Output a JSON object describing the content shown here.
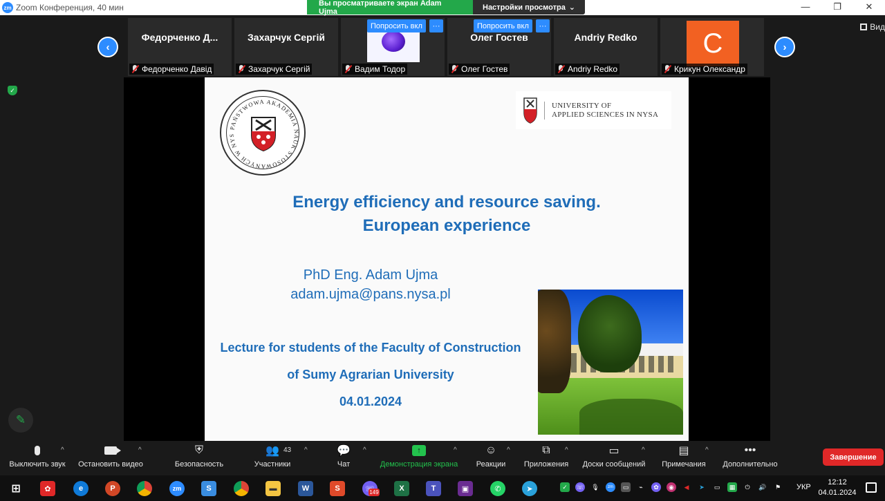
{
  "window": {
    "title": "Zoom Конференция, 40 мин",
    "logo_text": "zm"
  },
  "share_banner": {
    "viewing_text": "Вы просматриваете экран Adam Ujma",
    "view_settings": "Настройки просмотра"
  },
  "view_button": {
    "label": "Вид"
  },
  "participants": [
    {
      "display": "Федорченко Д...",
      "name": "Федорченко Давід",
      "type": "name"
    },
    {
      "display": "Захарчук Сергій",
      "name": "Захарчук Сергій",
      "type": "name"
    },
    {
      "display": "",
      "name": "Вадим Тодор",
      "type": "image",
      "ask_label": "Попросить вкл"
    },
    {
      "display": "Олег Гостев",
      "name": "Олег Гостев",
      "type": "name",
      "ask_label": "Попросить вкл"
    },
    {
      "display": "Andriy Redko",
      "name": "Andriy Redko",
      "type": "name"
    },
    {
      "display": "C",
      "name": "Крикун Олександр",
      "type": "avatar",
      "avatar_color": "#f26122"
    }
  ],
  "slide": {
    "seal_text": "PAŃSTWOWA AKADEMIA NAUK STOSOWANYCH W NYSIE",
    "university_logo": [
      "UNIVERSITY OF",
      "APPLIED SCIENCES IN NYSA"
    ],
    "title_line1": "Energy efficiency and resource saving.",
    "title_line2": "European experience",
    "author": "PhD Eng. Adam Ujma",
    "email": "adam.ujma@pans.nysa.pl",
    "lecture_line1": "Lecture for students of the Faculty of Construction",
    "lecture_line2": "of Sumy Agrarian University",
    "date": "04.01.2024",
    "accent_color": "#1f6db8"
  },
  "toolbar": {
    "mute": "Выключить звук",
    "stop_video": "Остановить видео",
    "security": "Безопасность",
    "participants": "Участники",
    "participants_count": "43",
    "chat": "Чат",
    "share_screen": "Демонстрация экрана",
    "reactions": "Реакции",
    "apps": "Приложения",
    "whiteboards": "Доски сообщений",
    "notes": "Примечания",
    "more": "Дополнительно",
    "end": "Завершение"
  },
  "taskbar": {
    "viber_badge": "149",
    "language": "УКР",
    "time": "12:12",
    "date": "04.01.2024"
  }
}
